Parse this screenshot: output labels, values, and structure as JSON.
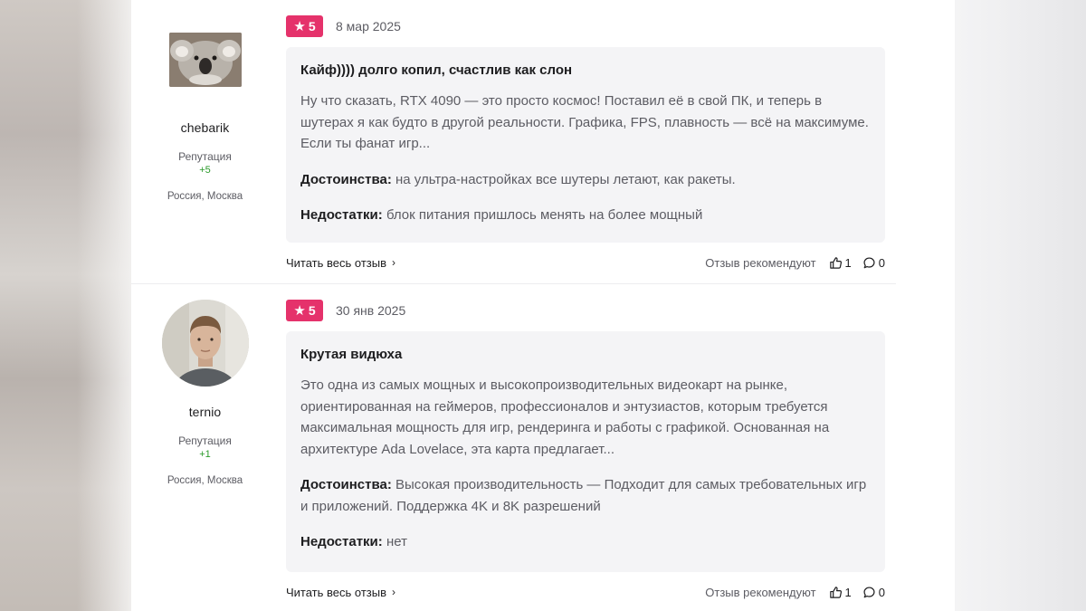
{
  "reviews": [
    {
      "author": {
        "name": "chebarik",
        "reputation_label": "Репутация",
        "reputation_value": "+5",
        "location": "Россия, Москва",
        "avatar_icon": "koala-photo"
      },
      "rating": "5",
      "date": "8 мар 2025",
      "title": "Кайф)))) долго копил, счастлив как слон",
      "text": "Ну что сказать, RTX 4090 — это просто космос! Поставил её в свой ПК, и теперь в шутерах я как будто в другой реальности. Графика, FPS, плавность — всё на максимуме. Если ты фанат игр...",
      "pros_label": "Достоинства:",
      "pros": "на ультра-настройках все шутеры летают, как ракеты.",
      "cons_label": "Недостатки:",
      "cons": "блок питания пришлось менять на более мощный",
      "read_more": "Читать весь отзыв",
      "recommend_label": "Отзыв рекомендуют",
      "likes": "1",
      "comments": "0"
    },
    {
      "author": {
        "name": "ternio",
        "reputation_label": "Репутация",
        "reputation_value": "+1",
        "location": "Россия, Москва",
        "avatar_icon": "person-photo"
      },
      "rating": "5",
      "date": "30 янв 2025",
      "title": "Крутая видюха",
      "text": "Это одна из самых мощных и высокопроизводительных видеокарт на рынке, ориентированная на геймеров, профессионалов и энтузиастов, которым требуется максимальная мощность для игр, рендеринга и работы с графикой. Основанная на архитектуре Ada Lovelace, эта карта предлагает...",
      "pros_label": "Достоинства:",
      "pros": "Высокая производительность — Подходит для самых требовательных игр и приложений. Поддержка 4K и 8K разрешений",
      "cons_label": "Недостатки:",
      "cons": "нет",
      "read_more": "Читать весь отзыв",
      "recommend_label": "Отзыв рекомендуют",
      "likes": "1",
      "comments": "0"
    }
  ],
  "colors": {
    "rating_badge": "#e5326b",
    "reputation": "#2a9a2a",
    "card_bg": "#f4f4f6"
  }
}
